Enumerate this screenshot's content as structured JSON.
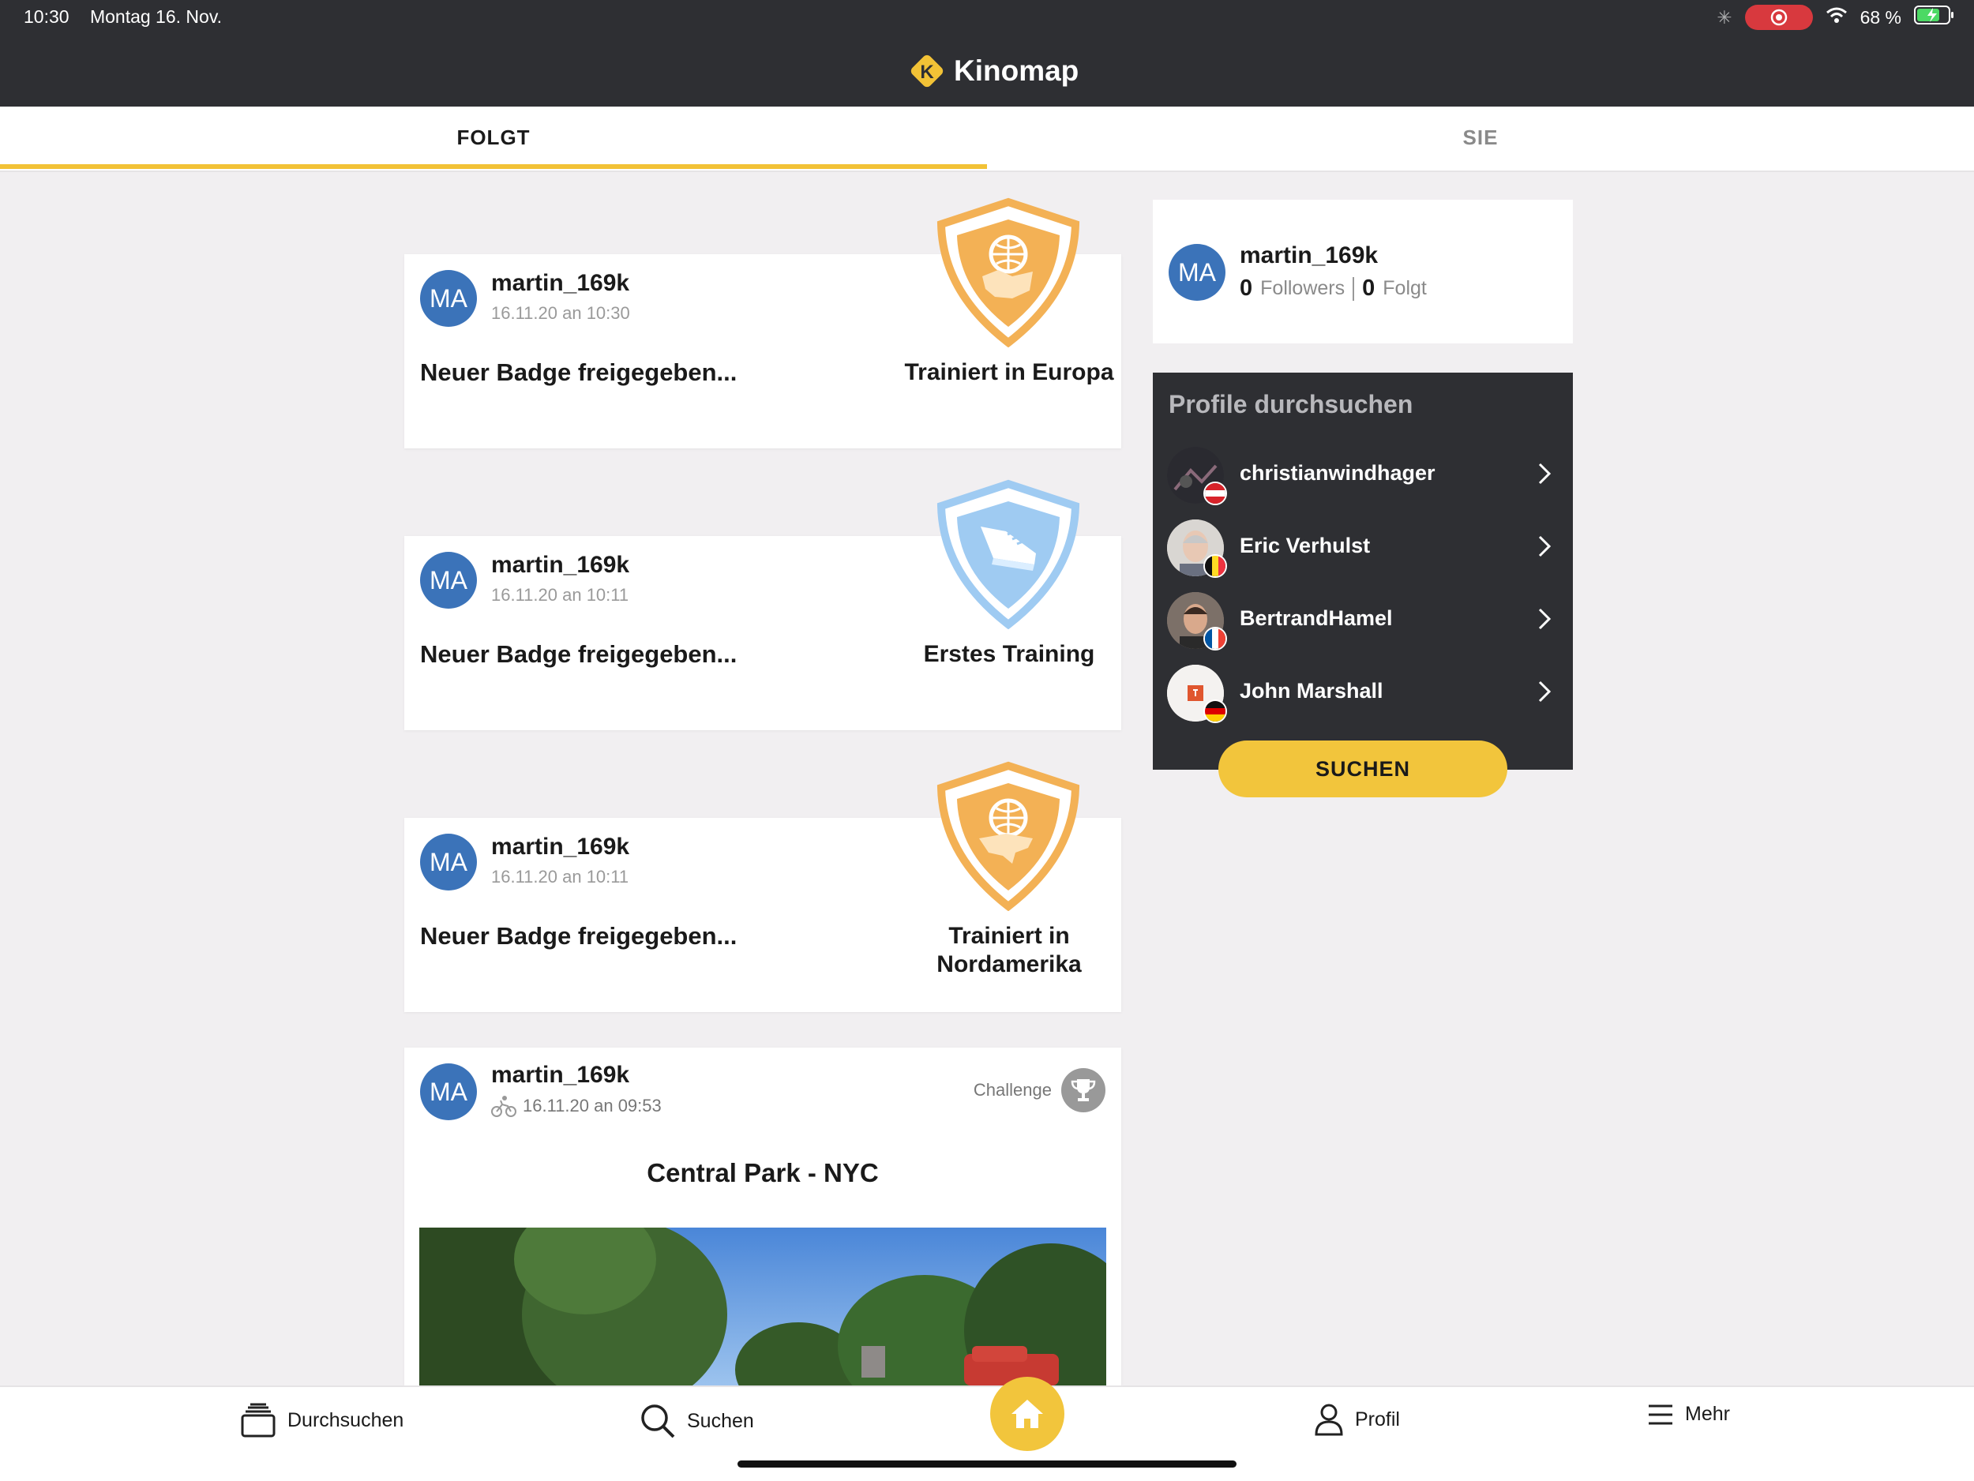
{
  "status_bar": {
    "time": "10:30",
    "date": "Montag 16. Nov.",
    "battery": "68 %"
  },
  "app": {
    "title": "Kinomap",
    "logo_letter": "K"
  },
  "tabs": [
    {
      "label": "FOLGT",
      "active": true
    },
    {
      "label": "SIE",
      "active": false
    }
  ],
  "feed": [
    {
      "initials": "MA",
      "user": "martin_169k",
      "time": "16.11.20 an 10:30",
      "headline": "Neuer Badge freigegeben...",
      "badge_label": "Trainiert in Europa",
      "badge_color": "#f3b155"
    },
    {
      "initials": "MA",
      "user": "martin_169k",
      "time": "16.11.20 an 10:11",
      "headline": "Neuer Badge freigegeben...",
      "badge_label": "Erstes Training",
      "badge_color": "#9fcbf2"
    },
    {
      "initials": "MA",
      "user": "martin_169k",
      "time": "16.11.20 an 10:11",
      "headline": "Neuer Badge freigegeben...",
      "badge_label": "Trainiert in Nordamerika",
      "badge_label_line1": "Trainiert in",
      "badge_label_line2": "Nordamerika",
      "badge_color": "#f3b155"
    },
    {
      "initials": "MA",
      "user": "martin_169k",
      "time": "16.11.20 an 09:53",
      "tag": "Challenge",
      "title": "Central Park - NYC"
    }
  ],
  "profile": {
    "initials": "MA",
    "user": "martin_169k",
    "followers_count": "0",
    "followers_label": "Followers",
    "following_count": "0",
    "following_label": "Folgt"
  },
  "browse": {
    "title": "Profile durchsuchen",
    "profiles": [
      {
        "name": "christianwindhager",
        "flag": "AT"
      },
      {
        "name": "Eric Verhulst",
        "flag": "BE"
      },
      {
        "name": "BertrandHamel",
        "flag": "FR"
      },
      {
        "name": "John Marshall",
        "flag": "DE"
      }
    ],
    "button": "SUCHEN"
  },
  "nav": {
    "browse": "Durchsuchen",
    "search": "Suchen",
    "profile": "Profil",
    "more": "Mehr"
  },
  "colors": {
    "accent": "#f2c53c",
    "header": "#2e2f33",
    "avatar": "#3b73b9"
  }
}
